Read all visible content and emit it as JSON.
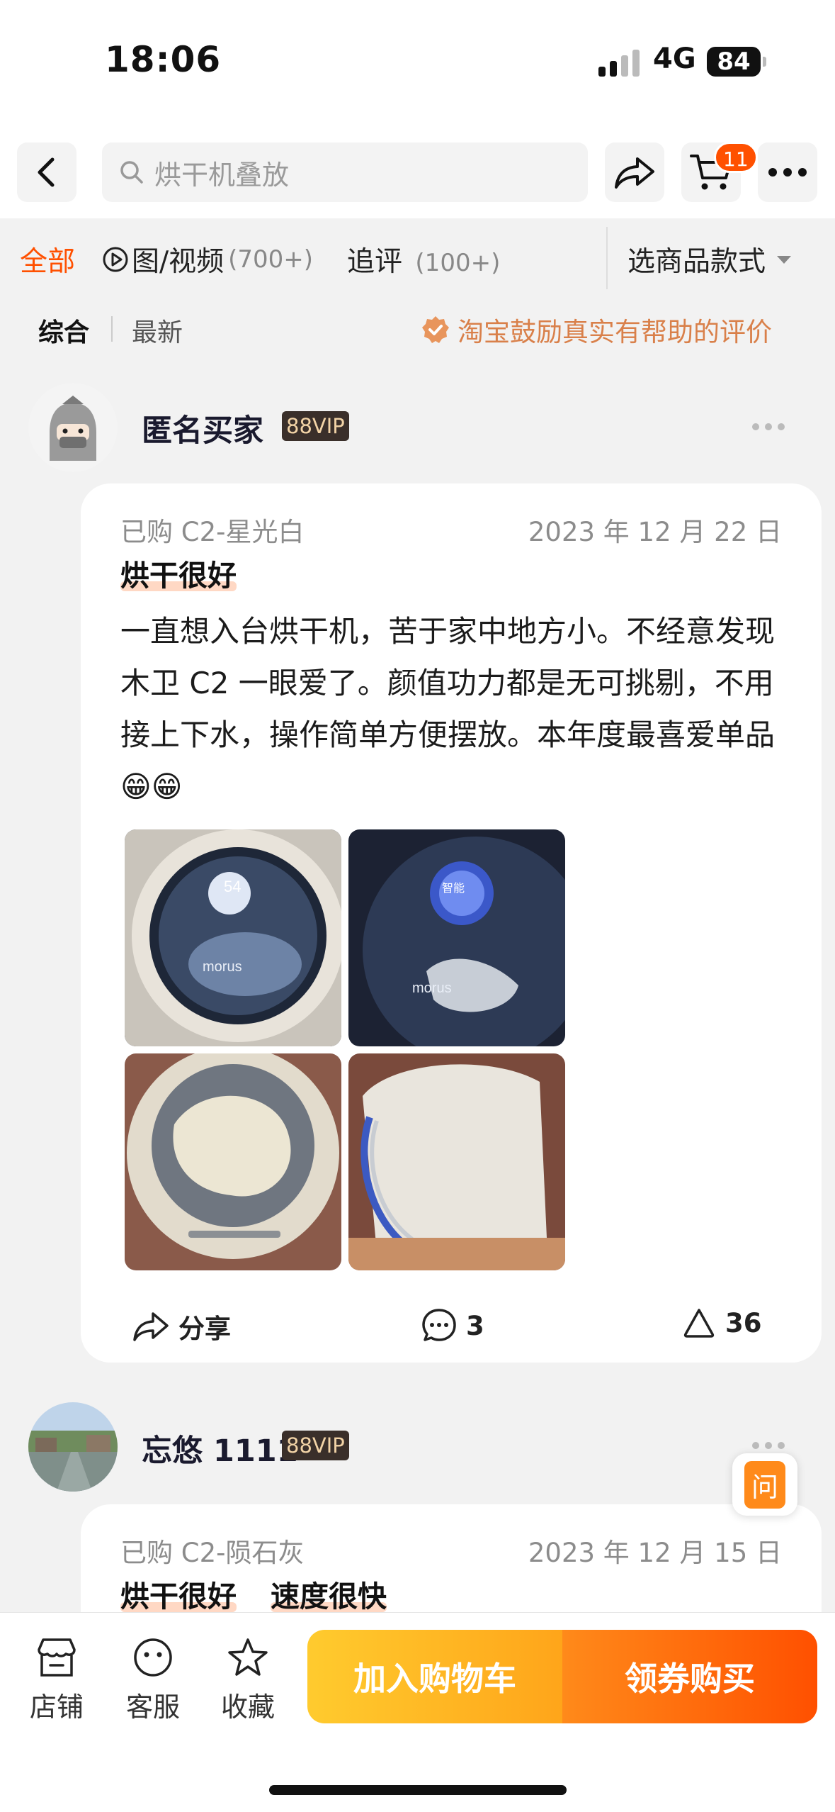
{
  "status": {
    "time": "18:06",
    "network": "4G",
    "battery": "84"
  },
  "nav": {
    "search_placeholder": "烘干机叠放",
    "cart_badge": "11"
  },
  "filters": {
    "tabs": [
      {
        "label": "全部",
        "count": ""
      },
      {
        "label": "图/视频",
        "count": "(700+)"
      },
      {
        "label": "追评",
        "count": "(100+)"
      }
    ],
    "style_select": "选商品款式"
  },
  "sort": {
    "options": [
      "综合",
      "最新"
    ],
    "notice": "淘宝鼓励真实有帮助的评价"
  },
  "reviews": [
    {
      "user": "匿名买家",
      "vip": "88VIP",
      "sku": "已购 C2-星光白",
      "date": "2023 年 12 月 22 日",
      "tags": [
        "烘干很好"
      ],
      "content": "一直想入台烘干机，苦于家中地方小。不经意发现木卫 C2 一眼爱了。颜值功力都是无可挑剔，不用接上下水，操作简单方便摆放。本年度最喜爱单品😁😁",
      "photo_text": [
        "54",
        "morus",
        "智能",
        "morus"
      ],
      "share_label": "分享",
      "comments": "3",
      "likes": "36"
    },
    {
      "user": "忘悠 1111",
      "vip": "88VIP",
      "sku": "已购 C2-陨石灰",
      "date": "2023 年 12 月 15 日",
      "tags": [
        "烘干很好",
        "速度很快"
      ]
    }
  ],
  "ask_label": "问",
  "bottom": {
    "items": [
      "店铺",
      "客服",
      "收藏"
    ],
    "add_cart": "加入购物车",
    "buy": "领券购买"
  }
}
